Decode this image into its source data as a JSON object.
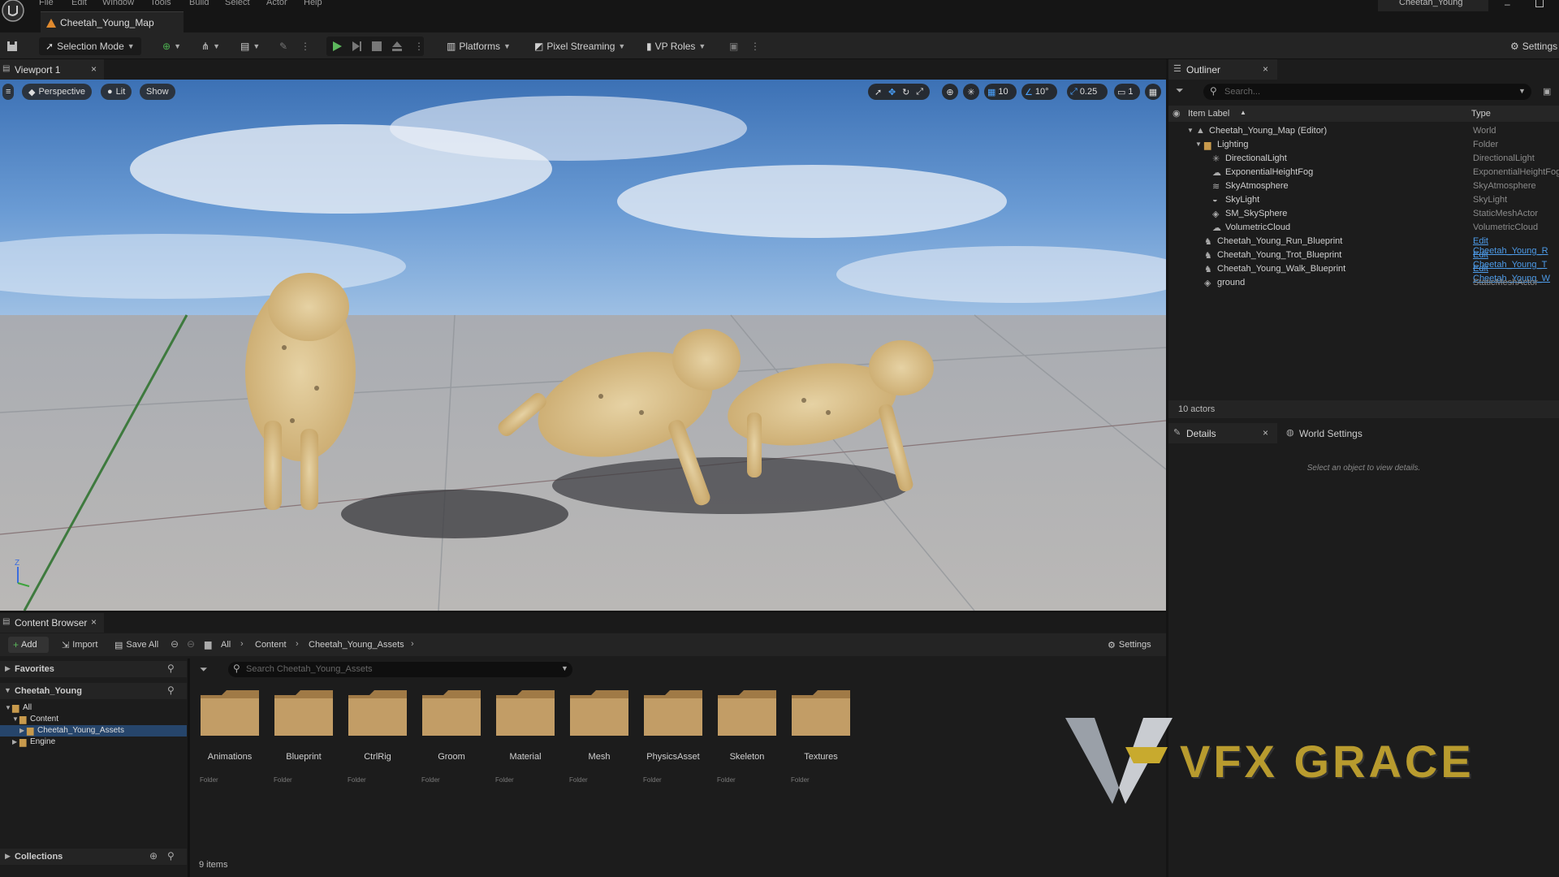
{
  "menu": [
    "File",
    "Edit",
    "Window",
    "Tools",
    "Build",
    "Select",
    "Actor",
    "Help"
  ],
  "project_name": "Cheetah_Young",
  "map_tab": "Cheetah_Young_Map",
  "toolbar": {
    "selection_mode": "Selection Mode",
    "platforms": "Platforms",
    "pixel_streaming": "Pixel Streaming",
    "vp_roles": "VP Roles",
    "settings": "Settings"
  },
  "viewport": {
    "tab": "Viewport 1",
    "perspective": "Perspective",
    "lit": "Lit",
    "show": "Show",
    "grid_snap": "10",
    "rot_snap": "10°",
    "scale_snap": "0.25",
    "camera_speed": "1",
    "axis_label": "Z"
  },
  "outliner": {
    "tab": "Outliner",
    "search_placeholder": "Search...",
    "col_label": "Item Label",
    "col_type": "Type",
    "rows": [
      {
        "label": "Cheetah_Young_Map (Editor)",
        "type": "World",
        "icon": "world-icon",
        "indent": 0
      },
      {
        "label": "Lighting",
        "type": "Folder",
        "icon": "folder-icon",
        "indent": 1
      },
      {
        "label": "DirectionalLight",
        "type": "DirectionalLight",
        "icon": "sun-icon",
        "indent": 2
      },
      {
        "label": "ExponentialHeightFog",
        "type": "ExponentialHeightFog",
        "icon": "fog-icon",
        "indent": 2
      },
      {
        "label": "SkyAtmosphere",
        "type": "SkyAtmosphere",
        "icon": "atmosphere-icon",
        "indent": 2
      },
      {
        "label": "SkyLight",
        "type": "SkyLight",
        "icon": "skylight-icon",
        "indent": 2
      },
      {
        "label": "SM_SkySphere",
        "type": "StaticMeshActor",
        "icon": "mesh-icon",
        "indent": 2
      },
      {
        "label": "VolumetricCloud",
        "type": "VolumetricCloud",
        "icon": "cloud-icon",
        "indent": 2
      },
      {
        "label": "Cheetah_Young_Run_Blueprint",
        "type": "Edit Cheetah_Young_R",
        "link": true,
        "icon": "blueprint-icon",
        "indent": 1
      },
      {
        "label": "Cheetah_Young_Trot_Blueprint",
        "type": "Edit Cheetah_Young_T",
        "link": true,
        "icon": "blueprint-icon",
        "indent": 1
      },
      {
        "label": "Cheetah_Young_Walk_Blueprint",
        "type": "Edit Cheetah_Young_W",
        "link": true,
        "icon": "blueprint-icon",
        "indent": 1
      },
      {
        "label": "ground",
        "type": "StaticMeshActor",
        "icon": "mesh-icon",
        "indent": 1
      }
    ],
    "actor_count": "10 actors"
  },
  "details": {
    "tab": "Details",
    "world_settings_tab": "World Settings",
    "empty_message": "Select an object to view details."
  },
  "content_browser": {
    "tab": "Content Browser",
    "add": "Add",
    "import": "Import",
    "save_all": "Save All",
    "breadcrumb": [
      "All",
      "Content",
      "Cheetah_Young_Assets"
    ],
    "settings": "Settings",
    "search_placeholder": "Search Cheetah_Young_Assets",
    "favorites": "Favorites",
    "project_section": "Cheetah_Young",
    "tree": [
      {
        "label": "All",
        "indent": 0
      },
      {
        "label": "Content",
        "indent": 1
      },
      {
        "label": "Cheetah_Young_Assets",
        "indent": 2,
        "selected": true
      },
      {
        "label": "Engine",
        "indent": 1
      }
    ],
    "collections": "Collections",
    "folders": [
      "Animations",
      "Blueprint",
      "CtrlRig",
      "Groom",
      "Material",
      "Mesh",
      "PhysicsAsset",
      "Skeleton",
      "Textures"
    ],
    "folder_type": "Folder",
    "item_count": "9 items"
  },
  "watermark": "VFX GRACE"
}
